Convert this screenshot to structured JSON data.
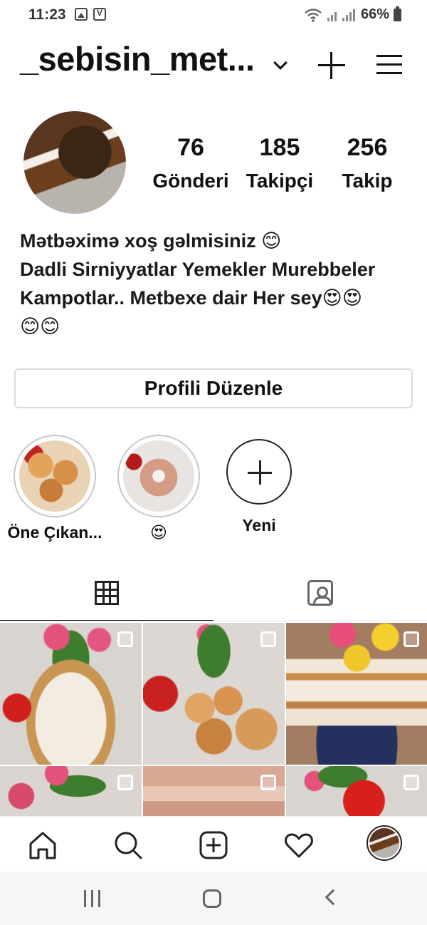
{
  "status_bar": {
    "time": "11:23",
    "battery": "66%",
    "icons": [
      "image-icon",
      "voicemail-icon",
      "wifi-icon",
      "signal-icon",
      "battery-icon"
    ]
  },
  "header": {
    "username": "_sebisin_met...",
    "icons": [
      "chevron-down-icon",
      "plus-icon",
      "menu-icon"
    ]
  },
  "profile": {
    "stats": [
      {
        "value": "76",
        "label": "Gönderi"
      },
      {
        "value": "185",
        "label": "Takipçi"
      },
      {
        "value": "256",
        "label": "Takip"
      }
    ],
    "bio_lines": [
      "Mətbəximə xoş gəlmisiniz 😊",
      "Dadli Sirniyyatlar Yemekler Murebbeler",
      "Kampotlar.. Metbexe dair Her sey😍😍",
      "😊😊"
    ],
    "edit_button": "Profili Düzenle"
  },
  "highlights": [
    {
      "label": "Öne Çıkan..."
    },
    {
      "label": "😍"
    },
    {
      "label": "Yeni"
    }
  ],
  "tabs": [
    "grid-icon",
    "tagged-icon"
  ],
  "colors": {
    "text": "#111111",
    "border": "#dbdbdb",
    "tab_active": "#111111"
  }
}
